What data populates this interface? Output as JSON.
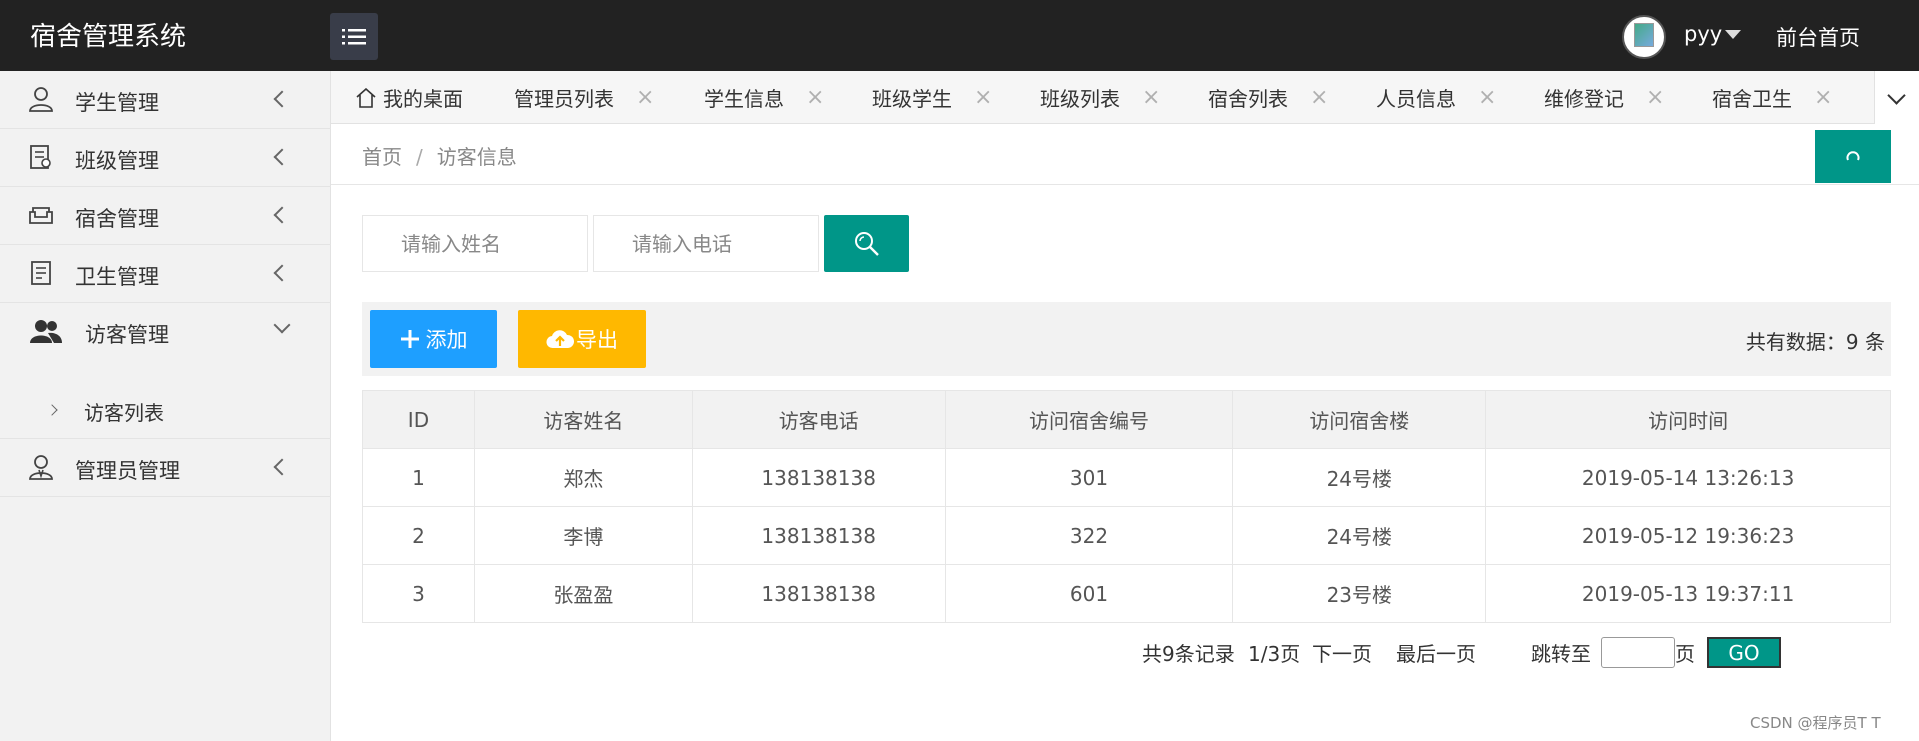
{
  "header": {
    "brand": "宿舍管理系统",
    "username": "pyy",
    "front_link": "前台首页"
  },
  "sidebar": {
    "items": [
      {
        "label": "学生管理",
        "icon": "user-icon"
      },
      {
        "label": "班级管理",
        "icon": "class-icon"
      },
      {
        "label": "宿舍管理",
        "icon": "sofa-icon"
      },
      {
        "label": "卫生管理",
        "icon": "notebook-icon"
      },
      {
        "label": "访客管理",
        "icon": "users-icon"
      },
      {
        "label": "管理员管理",
        "icon": "admin-icon"
      }
    ],
    "sub_item": "访客列表"
  },
  "tabs": [
    {
      "label": "我的桌面"
    },
    {
      "label": "管理员列表"
    },
    {
      "label": "学生信息"
    },
    {
      "label": "班级学生"
    },
    {
      "label": "班级列表"
    },
    {
      "label": "宿舍列表"
    },
    {
      "label": "人员信息"
    },
    {
      "label": "维修登记"
    },
    {
      "label": "宿舍卫生"
    }
  ],
  "breadcrumb": {
    "home": "首页",
    "separator": "/",
    "current": "访客信息"
  },
  "search": {
    "name_placeholder": "请输入姓名",
    "phone_placeholder": "请输入电话"
  },
  "toolbar": {
    "add_label": "添加",
    "export_label": "导出",
    "total_text": "共有数据：9 条"
  },
  "table": {
    "headers": [
      "ID",
      "访客姓名",
      "访客电话",
      "访问宿舍编号",
      "访问宿舍楼",
      "访问时间"
    ],
    "rows": [
      [
        "1",
        "郑杰",
        "138138138",
        "301",
        "24号楼",
        "2019-05-14 13:26:13"
      ],
      [
        "2",
        "李博",
        "138138138",
        "322",
        "24号楼",
        "2019-05-12 19:36:23"
      ],
      [
        "3",
        "张盈盈",
        "138138138",
        "601",
        "23号楼",
        "2019-05-13 19:37:11"
      ]
    ]
  },
  "pagination": {
    "records": "共9条记录",
    "page": "1/3页",
    "next": "下一页",
    "last": "最后一页",
    "goto_label": "跳转至",
    "page_unit": "页",
    "go": "GO"
  },
  "watermark": "CSDN @程序员T T",
  "colors": {
    "header_bg": "#222222",
    "primary": "#009688",
    "add_btn": "#1E9FFF",
    "export_btn": "#FFB800"
  }
}
